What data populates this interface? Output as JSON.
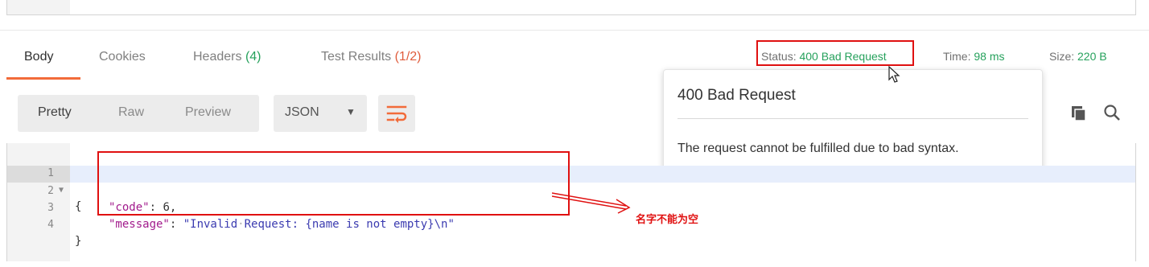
{
  "response_tabs": [
    {
      "label": "Body",
      "count": ""
    },
    {
      "label": "Cookies",
      "count": ""
    },
    {
      "label": "Headers",
      "count": "(4)"
    },
    {
      "label": "Test Results",
      "count": "(1/2)"
    }
  ],
  "meta": {
    "status_label": "Status:",
    "status_value": "400 Bad Request",
    "time_label": "Time:",
    "time_value": "98 ms",
    "size_label": "Size:",
    "size_value": "220 B"
  },
  "toolbar": {
    "views": [
      "Pretty",
      "Raw",
      "Preview"
    ],
    "active_view": "Pretty",
    "format": "JSON",
    "icons": [
      "wrap-lines-icon",
      "copy-icon",
      "search-icon"
    ]
  },
  "tooltip": {
    "title": "400 Bad Request",
    "body": "The request cannot be fulfilled due to bad syntax."
  },
  "code": {
    "line_numbers": [
      "1",
      "2",
      "3",
      "4"
    ],
    "key_code": "\"code\"",
    "value_code": "6",
    "key_message": "\"message\"",
    "value_message_1": "\"Invalid",
    "value_message_2": "Request: {name is not empty}\\n\""
  },
  "annotation": {
    "note": "名字不能为空"
  },
  "colors": {
    "accent": "#f26b3a",
    "success": "#26a15c",
    "error": "#e05c3c",
    "annotation": "#e01010"
  }
}
